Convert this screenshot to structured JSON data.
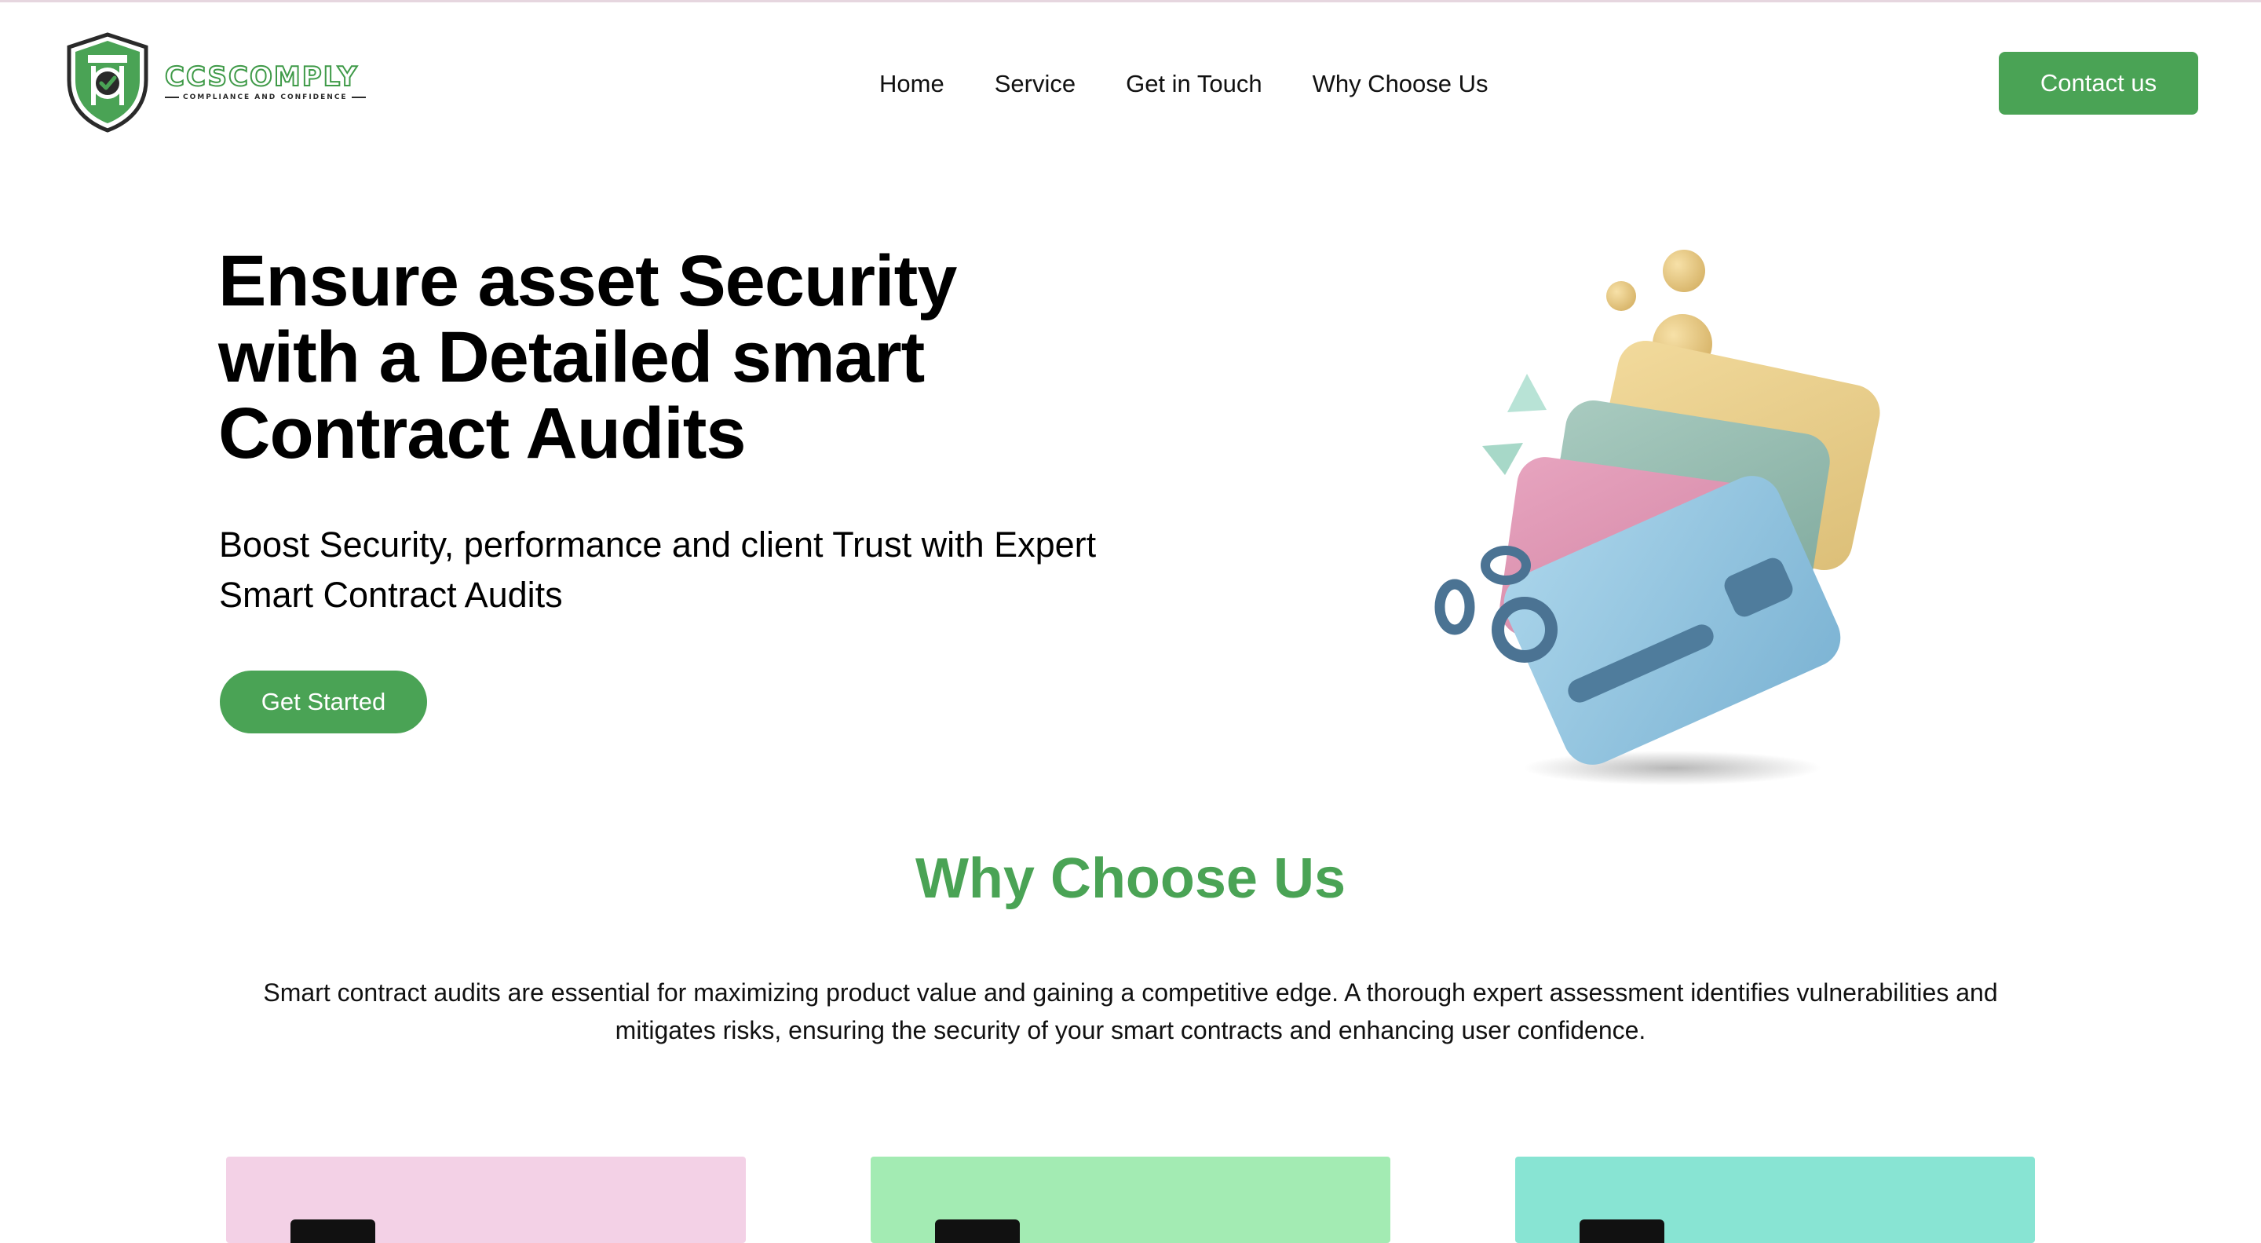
{
  "colors": {
    "accent": "#4aa355",
    "card_1": "#f3d1e6",
    "card_2": "#a3ebb3",
    "card_3": "#88e4d3"
  },
  "header": {
    "logo": {
      "name": "CCSCOMPLY",
      "tagline": "COMPLIANCE AND CONFIDENCE",
      "icon": "shield-check-icon"
    },
    "nav": [
      {
        "label": "Home"
      },
      {
        "label": "Service"
      },
      {
        "label": "Get in Touch"
      },
      {
        "label": "Why Choose Us"
      }
    ],
    "cta_label": "Contact us"
  },
  "hero": {
    "title": "Ensure asset Security with a Detailed smart Contract Audits",
    "subtitle": "Boost Security, performance and client Trust with Expert Smart Contract Audits",
    "button_label": "Get Started",
    "illustration": "credit-cards-illustration"
  },
  "why": {
    "title": "Why Choose Us",
    "text": "Smart contract audits are essential for maximizing product value and gaining a competitive edge. A thorough expert assessment identifies vulnerabilities and mitigates risks, ensuring the security of your smart contracts and enhancing user confidence."
  }
}
